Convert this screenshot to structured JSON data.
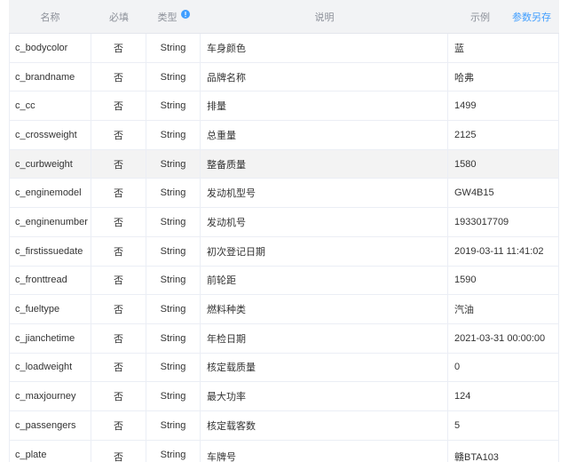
{
  "table": {
    "headers": {
      "name": "名称",
      "required": "必填",
      "type": "类型",
      "description": "说明",
      "example": "示例",
      "save_params": "参数另存"
    },
    "rows": [
      {
        "name": "c_bodycolor",
        "required": "否",
        "type": "String",
        "description": "车身颜色",
        "example": "蓝"
      },
      {
        "name": "c_brandname",
        "required": "否",
        "type": "String",
        "description": "品牌名称",
        "example": "哈弗"
      },
      {
        "name": "c_cc",
        "required": "否",
        "type": "String",
        "description": "排量",
        "example": "1499"
      },
      {
        "name": "c_crossweight",
        "required": "否",
        "type": "String",
        "description": "总重量",
        "example": "2125"
      },
      {
        "name": "c_curbweight",
        "required": "否",
        "type": "String",
        "description": "整备质量",
        "example": "1580",
        "hovered": true
      },
      {
        "name": "c_enginemodel",
        "required": "否",
        "type": "String",
        "description": "发动机型号",
        "example": "GW4B15"
      },
      {
        "name": "c_enginenumber",
        "required": "否",
        "type": "String",
        "description": "发动机号",
        "example": "1933017709"
      },
      {
        "name": "c_firstissuedate",
        "required": "否",
        "type": "String",
        "description": "初次登记日期",
        "example": "2019-03-11 11:41:02"
      },
      {
        "name": "c_fronttread",
        "required": "否",
        "type": "String",
        "description": "前轮距",
        "example": "1590"
      },
      {
        "name": "c_fueltype",
        "required": "否",
        "type": "String",
        "description": "燃料种类",
        "example": "汽油"
      },
      {
        "name": "c_jianchetime",
        "required": "否",
        "type": "String",
        "description": "年检日期",
        "example": "2021-03-31 00:00:00"
      },
      {
        "name": "c_loadweight",
        "required": "否",
        "type": "String",
        "description": "核定载质量",
        "example": "0"
      },
      {
        "name": "c_maxjourney",
        "required": "否",
        "type": "String",
        "description": "最大功率",
        "example": "124"
      },
      {
        "name": "c_passengers",
        "required": "否",
        "type": "String",
        "description": "核定载客数",
        "example": "5"
      },
      {
        "name": "c_plate",
        "required": "否",
        "type": "String",
        "description": "车牌号",
        "example": "赣BTA103"
      }
    ]
  },
  "icons": {
    "type_header_hint": "info-icon"
  },
  "colors": {
    "accent": "#409eff",
    "header_background": "#f2f3f5",
    "hover_row_background": "#f3f3f3",
    "border": "#ebeef5",
    "text": "#333333",
    "header_text": "#8c9099"
  }
}
